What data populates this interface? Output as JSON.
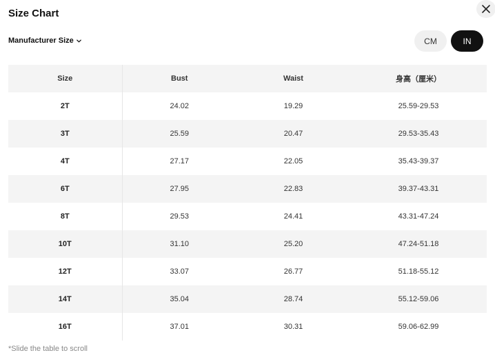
{
  "title": "Size Chart",
  "size_selector": {
    "label": "Manufacturer Size"
  },
  "units": {
    "cm": "CM",
    "in": "IN",
    "selected": "IN"
  },
  "table": {
    "headers": [
      "Size",
      "Bust",
      "Waist",
      "身高（厘米）"
    ],
    "rows": [
      [
        "2T",
        "24.02",
        "19.29",
        "25.59-29.53"
      ],
      [
        "3T",
        "25.59",
        "20.47",
        "29.53-35.43"
      ],
      [
        "4T",
        "27.17",
        "22.05",
        "35.43-39.37"
      ],
      [
        "6T",
        "27.95",
        "22.83",
        "39.37-43.31"
      ],
      [
        "8T",
        "29.53",
        "24.41",
        "43.31-47.24"
      ],
      [
        "10T",
        "31.10",
        "25.20",
        "47.24-51.18"
      ],
      [
        "12T",
        "33.07",
        "26.77",
        "51.18-55.12"
      ],
      [
        "14T",
        "35.04",
        "28.74",
        "55.12-59.06"
      ],
      [
        "16T",
        "37.01",
        "30.31",
        "59.06-62.99"
      ]
    ]
  },
  "footnote": "*Slide the table to scroll",
  "colors": {
    "active_toggle": "#111111",
    "row_shade": "#f4f4f4"
  }
}
